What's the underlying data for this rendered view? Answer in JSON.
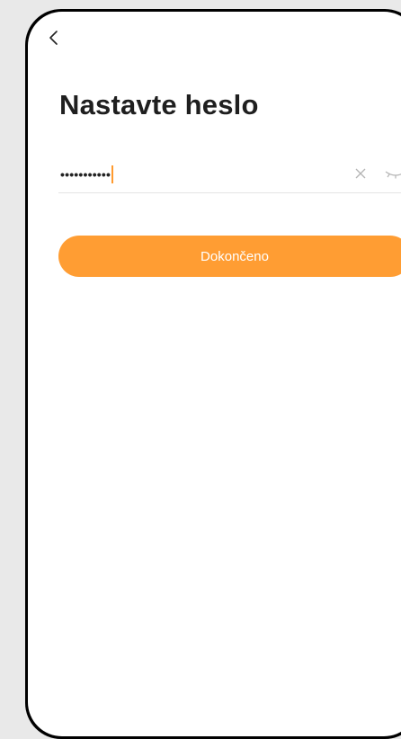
{
  "header": {
    "back_icon": "chevron-left-icon"
  },
  "page": {
    "title": "Nastavte heslo"
  },
  "password_field": {
    "value": "•••••••••••",
    "clear_icon": "close-icon",
    "visibility_icon": "eye-closed-icon"
  },
  "actions": {
    "done_label": "Dokončeno"
  },
  "colors": {
    "accent": "#ff9d33",
    "caret": "#ff9a2e",
    "title_text": "#1f1f1f",
    "divider": "#e3e3e3",
    "background": "#ffffff",
    "frame": "#000000"
  }
}
